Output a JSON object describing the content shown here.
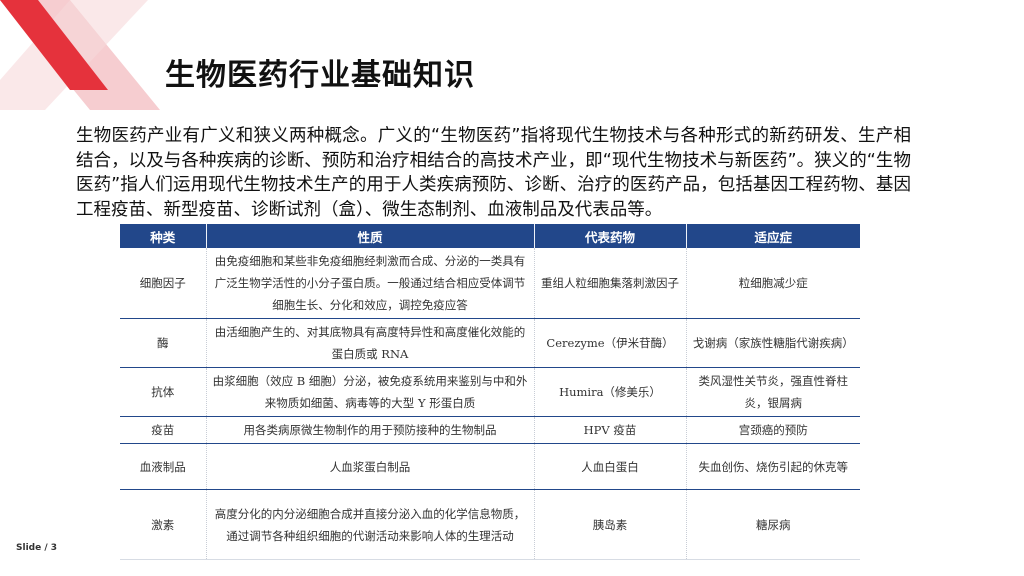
{
  "slide": {
    "title": "生物医药行业基础知识",
    "paragraph": "生物医药产业有广义和狭义两种概念。广义的“生物医药”指将现代生物技术与各种形式的新药研发、生产相结合，以及与各种疾病的诊断、预防和治疗相结合的高技术产业，即“现代生物技术与新医药”。狭义的“生物医药”指人们运用现代生物技术生产的用于人类疾病预防、诊断、治疗的医药产品，包括基因工程药物、基因工程疫苗、新型疫苗、诊断试剂（盒）、微生态制剂、血液制品及代表品等。",
    "slide_number": "Slide / 3",
    "colors": {
      "header_bg": "#22478a",
      "deco_red": "#e5323c",
      "deco_pink": "#f6cdd0"
    }
  },
  "table": {
    "headers": [
      "种类",
      "性质",
      "代表药物",
      "适应症"
    ],
    "rows": [
      {
        "type": "细胞因子",
        "nature": "由免疫细胞和某些非免疫细胞经刺激而合成、分泌的一类具有广泛生物学活性的小分子蛋白质。一般通过结合相应受体调节细胞生长、分化和效应，调控免疫应答",
        "drug": "重组人粒细胞集落刺激因子",
        "indication": "粒细胞减少症"
      },
      {
        "type": "酶",
        "nature": "由活细胞产生的、对其底物具有高度特异性和高度催化效能的蛋白质或 RNA",
        "drug": "Cerezyme（伊米苷酶）",
        "indication": "戈谢病（家族性糖脂代谢疾病）"
      },
      {
        "type": "抗体",
        "nature": "由浆细胞（效应 B 细胞）分泌，被免疫系统用来鉴别与中和外来物质如细菌、病毒等的大型 Y 形蛋白质",
        "drug": "Humira（修美乐）",
        "indication": "类风湿性关节炎，强直性脊柱炎，银屑病"
      },
      {
        "type": "疫苗",
        "nature": "用各类病原微生物制作的用于预防接种的生物制品",
        "drug": "HPV 疫苗",
        "indication": "宫颈癌的预防"
      },
      {
        "type": "血液制品",
        "nature": "人血浆蛋白制品",
        "drug": "人血白蛋白",
        "indication": "失血创伤、烧伤引起的休克等"
      },
      {
        "type": "激素",
        "nature": "高度分化的内分泌细胞合成并直接分泌入血的化学信息物质，通过调节各种组织细胞的代谢活动来影响人体的生理活动",
        "drug": "胰岛素",
        "indication": "糖尿病"
      }
    ]
  }
}
